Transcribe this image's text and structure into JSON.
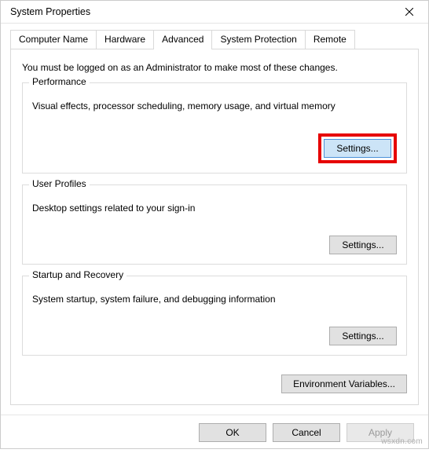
{
  "window": {
    "title": "System Properties"
  },
  "tabs": {
    "computer_name": "Computer Name",
    "hardware": "Hardware",
    "advanced": "Advanced",
    "system_protection": "System Protection",
    "remote": "Remote"
  },
  "intro": "You must be logged on as an Administrator to make most of these changes.",
  "performance": {
    "legend": "Performance",
    "desc": "Visual effects, processor scheduling, memory usage, and virtual memory",
    "button": "Settings..."
  },
  "user_profiles": {
    "legend": "User Profiles",
    "desc": "Desktop settings related to your sign-in",
    "button": "Settings..."
  },
  "startup": {
    "legend": "Startup and Recovery",
    "desc": "System startup, system failure, and debugging information",
    "button": "Settings..."
  },
  "env_button": "Environment Variables...",
  "footer": {
    "ok": "OK",
    "cancel": "Cancel",
    "apply": "Apply"
  },
  "watermark": "wsxdn.com"
}
